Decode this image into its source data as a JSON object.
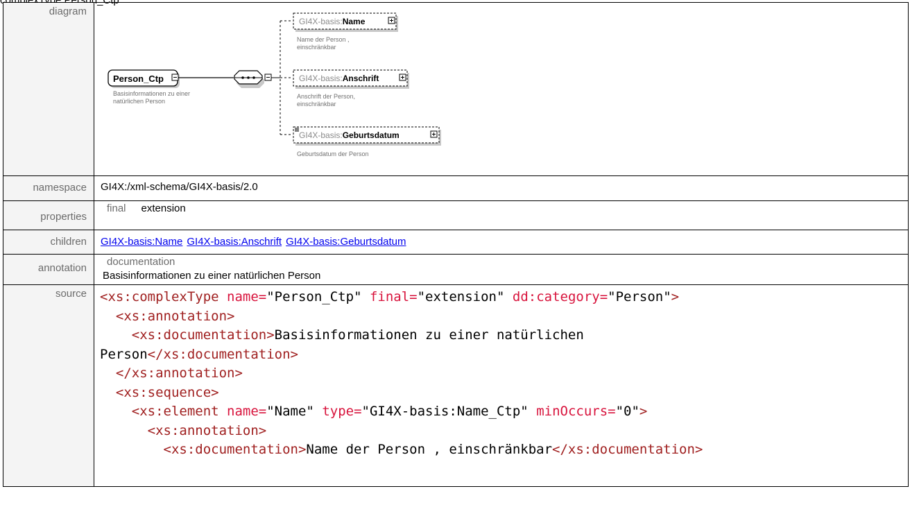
{
  "page": {
    "title": "complexType Person_Ctp"
  },
  "labels": {
    "diagram": "diagram",
    "namespace": "namespace",
    "properties": "properties",
    "children": "children",
    "annotation": "annotation",
    "source": "source"
  },
  "diagram": {
    "root_name": "Person_Ctp",
    "root_doc_line1": "Basisinformationen zu einer",
    "root_doc_line2": "natürlichen Person",
    "elements": [
      {
        "prefix": "GI4X-basis:",
        "name": "Name",
        "doc_line1": "Name der Person ,",
        "doc_line2": "einschränkbar"
      },
      {
        "prefix": "GI4X-basis:",
        "name": "Anschrift",
        "doc_line1": "Anschrift der Person,",
        "doc_line2": "einschränkbar"
      },
      {
        "prefix": "GI4X-basis:",
        "name": "Geburtsdatum",
        "doc_line1": "Geburtsdatum der Person",
        "doc_line2": ""
      }
    ],
    "colors": {
      "border": "#000000",
      "doc_text": "#707070",
      "prefix_text": "#8a8a8a",
      "shadow": "#c0c0c0"
    }
  },
  "namespace": "GI4X:/xml-schema/GI4X-basis/2.0",
  "properties": {
    "key": "final",
    "value": "extension"
  },
  "children": [
    "GI4X-basis:Name",
    "GI4X-basis:Anschrift",
    "GI4X-basis:Geburtsdatum"
  ],
  "annotation": {
    "key": "documentation",
    "value": "Basisinformationen zu einer natürlichen Person"
  },
  "source_lines": [
    [
      {
        "t": "<xs:complexType ",
        "c": "tag"
      },
      {
        "t": "name=",
        "c": "attr"
      },
      {
        "t": "\"Person_Ctp\" ",
        "c": "txt"
      },
      {
        "t": "final=",
        "c": "attr"
      },
      {
        "t": "\"extension\" ",
        "c": "txt"
      },
      {
        "t": "dd:category=",
        "c": "attr"
      },
      {
        "t": "\"Person\"",
        "c": "txt"
      },
      {
        "t": ">",
        "c": "tag"
      }
    ],
    [
      {
        "t": "  <xs:annotation>",
        "c": "tag"
      }
    ],
    [
      {
        "t": "    <xs:documentation>",
        "c": "tag"
      },
      {
        "t": "Basisinformationen zu einer natürlichen",
        "c": "txt"
      }
    ],
    [
      {
        "t": "Person",
        "c": "txt"
      },
      {
        "t": "</xs:documentation>",
        "c": "tag"
      }
    ],
    [
      {
        "t": "  </xs:annotation>",
        "c": "tag"
      }
    ],
    [
      {
        "t": "  <xs:sequence>",
        "c": "tag"
      }
    ],
    [
      {
        "t": "    <xs:element ",
        "c": "tag"
      },
      {
        "t": "name=",
        "c": "attr"
      },
      {
        "t": "\"Name\" ",
        "c": "txt"
      },
      {
        "t": "type=",
        "c": "attr"
      },
      {
        "t": "\"GI4X-basis:Name_Ctp\" ",
        "c": "txt"
      },
      {
        "t": "minOccurs=",
        "c": "attr"
      },
      {
        "t": "\"0\"",
        "c": "txt"
      },
      {
        "t": ">",
        "c": "tag"
      }
    ],
    [
      {
        "t": "      <xs:annotation>",
        "c": "tag"
      }
    ],
    [
      {
        "t": "        <xs:documentation>",
        "c": "tag"
      },
      {
        "t": "Name der Person , einschränkbar",
        "c": "txt"
      },
      {
        "t": "</xs:documentation>",
        "c": "tag"
      }
    ]
  ]
}
